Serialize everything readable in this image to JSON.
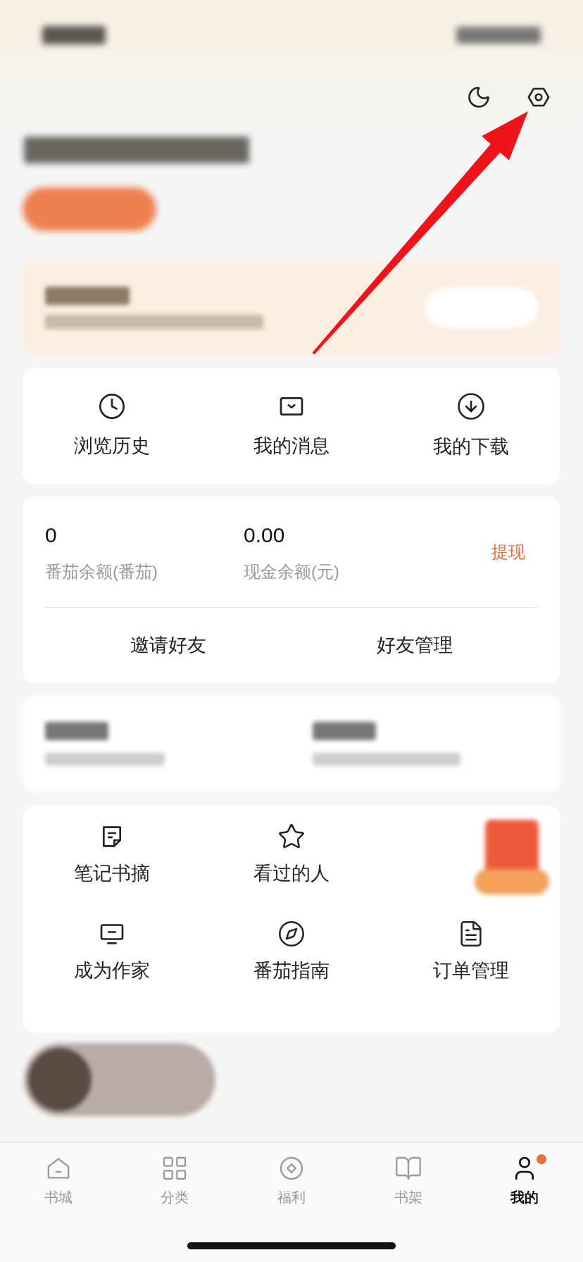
{
  "quick_links": [
    {
      "label": "浏览历史"
    },
    {
      "label": "我的消息"
    },
    {
      "label": "我的下载"
    }
  ],
  "wallet": {
    "items": [
      {
        "value": "0",
        "label": "番茄余额(番茄)"
      },
      {
        "value": "0.00",
        "label": "现金余额(元)"
      }
    ],
    "action": "提现"
  },
  "friends": [
    "邀请好友",
    "好友管理"
  ],
  "tools": [
    {
      "label": "笔记书摘"
    },
    {
      "label": "看过的人"
    },
    {
      "label": "成为作家"
    },
    {
      "label": "番茄指南"
    },
    {
      "label": "订单管理"
    }
  ],
  "nav": [
    {
      "label": "书城",
      "selected": false,
      "badge": false
    },
    {
      "label": "分类",
      "selected": false,
      "badge": false
    },
    {
      "label": "福利",
      "selected": false,
      "badge": false
    },
    {
      "label": "书架",
      "selected": false,
      "badge": false
    },
    {
      "label": "我的",
      "selected": true,
      "badge": true
    }
  ]
}
